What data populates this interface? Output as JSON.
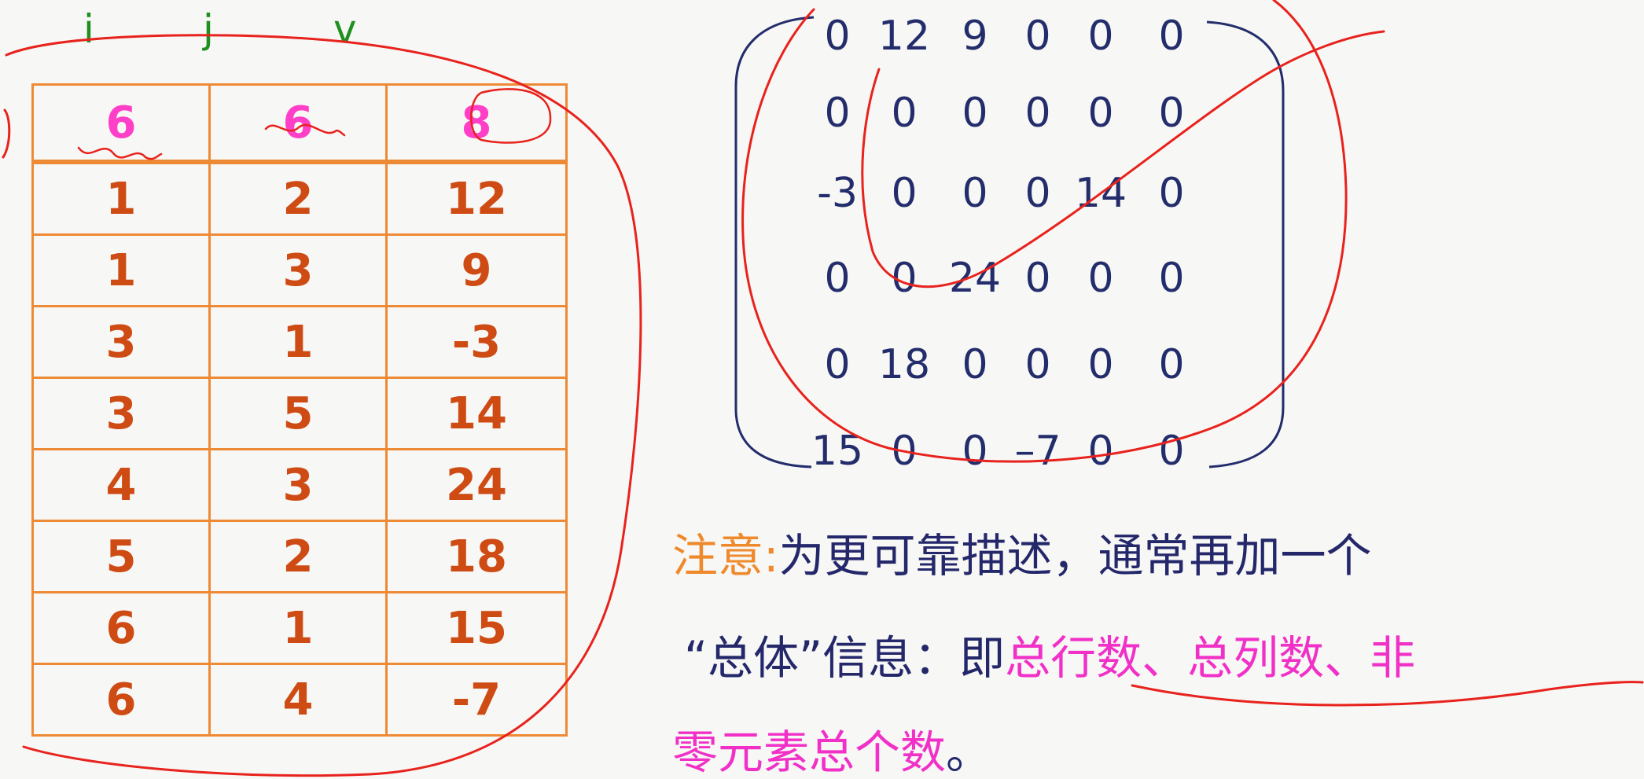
{
  "table": {
    "columns": [
      "i",
      "j",
      "v"
    ],
    "header_row": [
      "6",
      "6",
      "8"
    ],
    "rows": [
      [
        "1",
        "2",
        "12"
      ],
      [
        "1",
        "3",
        "9"
      ],
      [
        "3",
        "1",
        "-3"
      ],
      [
        "3",
        "5",
        "14"
      ],
      [
        "4",
        "3",
        "24"
      ],
      [
        "5",
        "2",
        "18"
      ],
      [
        "6",
        "1",
        "15"
      ],
      [
        "6",
        "4",
        "-7"
      ]
    ]
  },
  "matrix": {
    "rows": [
      [
        "0",
        "12",
        "9",
        "0",
        "0",
        "0"
      ],
      [
        "0",
        "0",
        "0",
        "0",
        "0",
        "0"
      ],
      [
        "-3",
        "0",
        "0",
        "0",
        "14",
        "0"
      ],
      [
        "0",
        "0",
        "24",
        "0",
        "0",
        "0"
      ],
      [
        "0",
        "18",
        "0",
        "0",
        "0",
        "0"
      ],
      [
        "15",
        "0",
        "0",
        "–7",
        "0",
        "0"
      ]
    ]
  },
  "note": {
    "label": "注意:",
    "line1": "为更可靠描述，通常再加一个",
    "line2_plain": "“总体”信息：即",
    "line2_highlight": "总行数、总列数、非",
    "line3_highlight": "零元素总个数",
    "line3_end": "。"
  },
  "colors": {
    "table_border": "#ee8a35",
    "table_text": "#cf4b14",
    "header_values": "#ff3fc8",
    "column_labels": "#1f8f1f",
    "matrix_text": "#232d6c",
    "annotation_ink": "#e8221c",
    "note_label": "#ef8a2c",
    "note_text": "#24286b",
    "note_highlight": "#f130c8"
  }
}
